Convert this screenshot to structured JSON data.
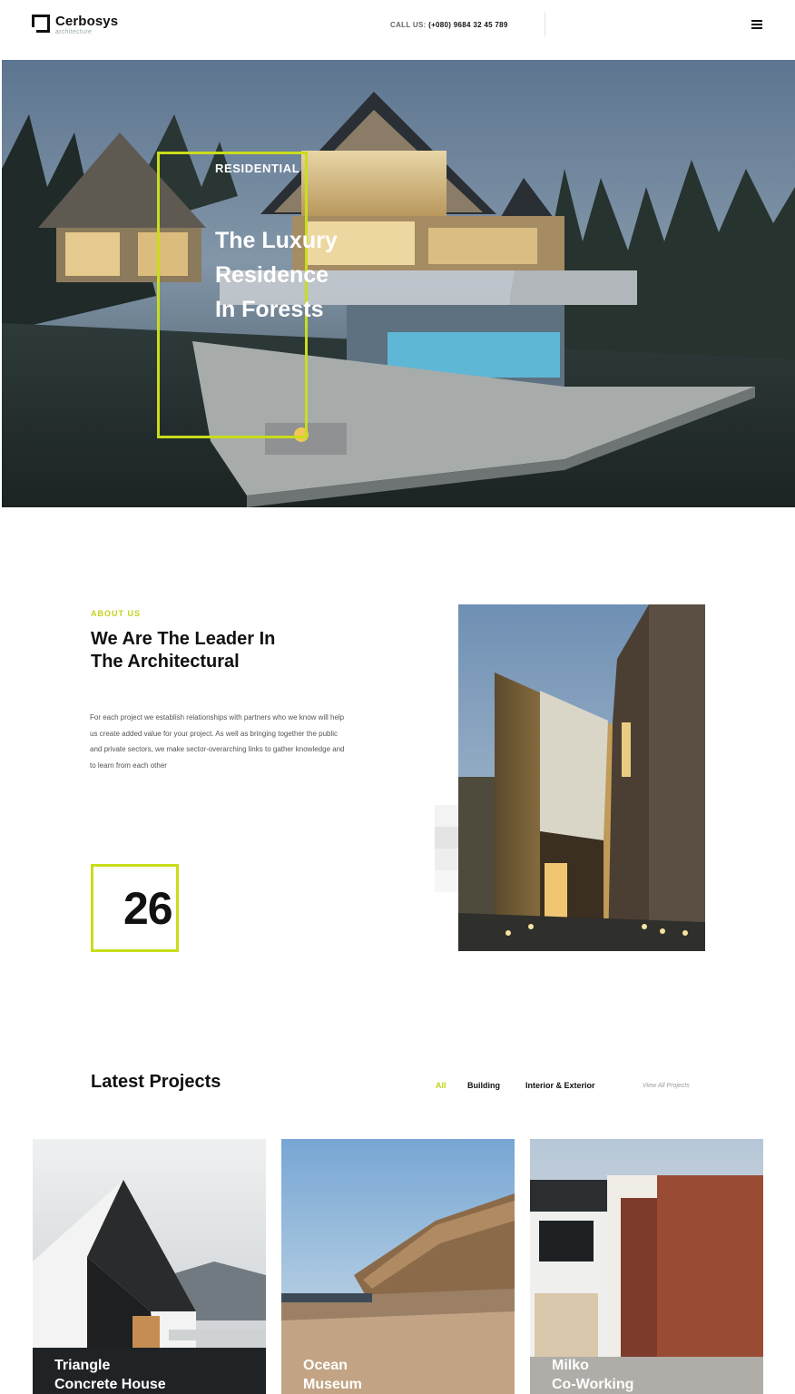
{
  "header": {
    "logo_name": "Cerbosys",
    "logo_sub": "architecture",
    "call_label": "CALL US:",
    "phone": "(+080) 9684 32 45 789"
  },
  "hero": {
    "category": "RESIDENTIAL",
    "title_line1": "The Luxury",
    "title_line2": "Residence",
    "title_line3": "In Forests"
  },
  "about": {
    "kicker": "ABOUT US",
    "title_line1": "We Are The Leader In",
    "title_line2": "The Architectural",
    "body_line1": "For each project we establish relationships with partners who we know will help",
    "body_line2": "us create added value for your project. As well as bringing together the public",
    "body_line3": "and private sectors, we make sector-overarching links to gather knowledge and",
    "body_line4": "to learn from each other",
    "counter": "26"
  },
  "projects": {
    "title": "Latest Projects",
    "filters": [
      "All",
      "Building",
      "Interior & Exterior"
    ],
    "view_all": "View All Projects",
    "cards": [
      {
        "line1": "Triangle",
        "line2": "Concrete House"
      },
      {
        "line1": "Ocean",
        "line2": "Museum"
      },
      {
        "line1": "Milko",
        "line2": "Co-Working"
      }
    ]
  },
  "colors": {
    "accent": "#c9dd1d",
    "text": "#111111",
    "muted": "#555555"
  }
}
